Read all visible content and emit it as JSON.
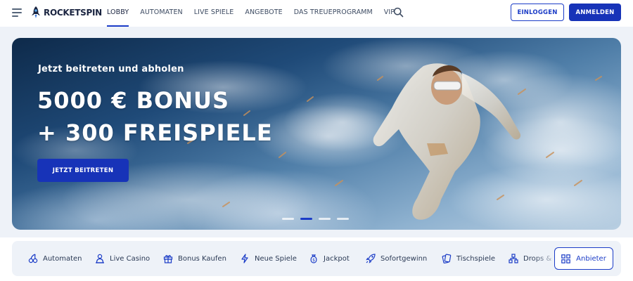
{
  "header": {
    "logo_text": "ROCKETSPIN",
    "nav": [
      {
        "label": "LOBBY",
        "active": true
      },
      {
        "label": "AUTOMATEN",
        "active": false
      },
      {
        "label": "LIVE SPIELE",
        "active": false
      },
      {
        "label": "ANGEBOTE",
        "active": false
      },
      {
        "label": "DAS TREUEPROGRAMM",
        "active": false
      },
      {
        "label": "VIP",
        "active": false
      }
    ],
    "login_label": "EINLOGGEN",
    "signup_label": "ANMELDEN"
  },
  "hero": {
    "subtitle": "Jetzt beitreten und abholen",
    "title_line1": "5000 € BONUS",
    "title_line2": "+ 300 FREISPIELE",
    "cta_label": "JETZT BEITRETEN",
    "slides_total": 4,
    "active_slide": 2
  },
  "categories": [
    {
      "label": "Automaten",
      "icon": "cherries-icon"
    },
    {
      "label": "Live Casino",
      "icon": "dealer-icon"
    },
    {
      "label": "Bonus Kaufen",
      "icon": "gift-icon"
    },
    {
      "label": "Neue Spiele",
      "icon": "lightning-icon"
    },
    {
      "label": "Jackpot",
      "icon": "money-bag-icon"
    },
    {
      "label": "Sofortgewinn",
      "icon": "rocket-icon"
    },
    {
      "label": "Tischspiele",
      "icon": "cards-icon"
    },
    {
      "label": "Drops & Wins",
      "icon": "hierarchy-icon"
    }
  ],
  "providers_label": "Anbieter",
  "colors": {
    "primary": "#1733b8",
    "accent_border": "#1b3cc7",
    "text_dark": "#1a2440",
    "category_bg": "#eef2f8"
  }
}
